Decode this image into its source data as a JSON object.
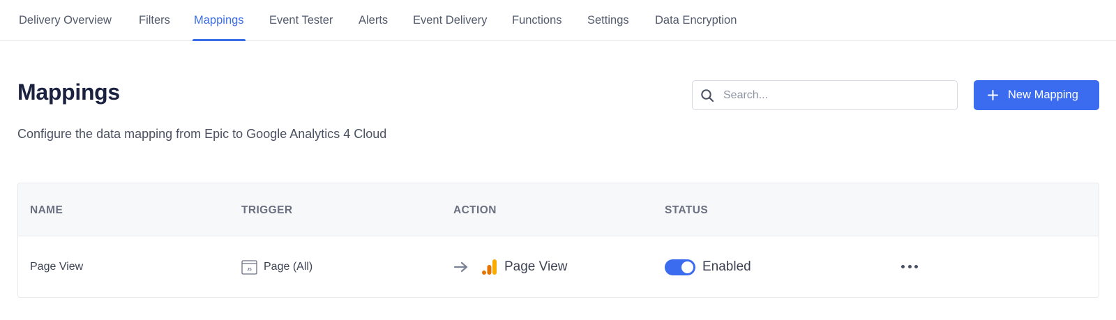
{
  "tabs": [
    {
      "label": "Delivery Overview",
      "active": false
    },
    {
      "label": "Filters",
      "active": false
    },
    {
      "label": "Mappings",
      "active": true
    },
    {
      "label": "Event Tester",
      "active": false
    },
    {
      "label": "Alerts",
      "active": false
    },
    {
      "label": "Event Delivery",
      "active": false
    },
    {
      "label": "Functions",
      "active": false
    },
    {
      "label": "Settings",
      "active": false
    },
    {
      "label": "Data Encryption",
      "active": false
    }
  ],
  "page": {
    "title": "Mappings",
    "subtitle": "Configure the data mapping from Epic to Google Analytics 4 Cloud"
  },
  "search": {
    "placeholder": "Search...",
    "value": "",
    "icon": "search-icon"
  },
  "new_button": {
    "label": "New Mapping",
    "icon": "plus-icon"
  },
  "table": {
    "columns": [
      "NAME",
      "TRIGGER",
      "ACTION",
      "STATUS"
    ],
    "rows": [
      {
        "name": "Page View",
        "trigger": "Page (All)",
        "trigger_icon": "javascript-browser-icon",
        "action": "Page View",
        "action_icons": [
          "arrow-right-icon",
          "google-analytics-icon"
        ],
        "enabled": true,
        "status": "Enabled",
        "menu_icon": "more-horizontal-icon"
      }
    ]
  },
  "colors": {
    "accent": "#3b6cf0",
    "tab_active": "#3b6de8",
    "ga_orange": "#f9ab00",
    "ga_dark_orange": "#e37400"
  }
}
